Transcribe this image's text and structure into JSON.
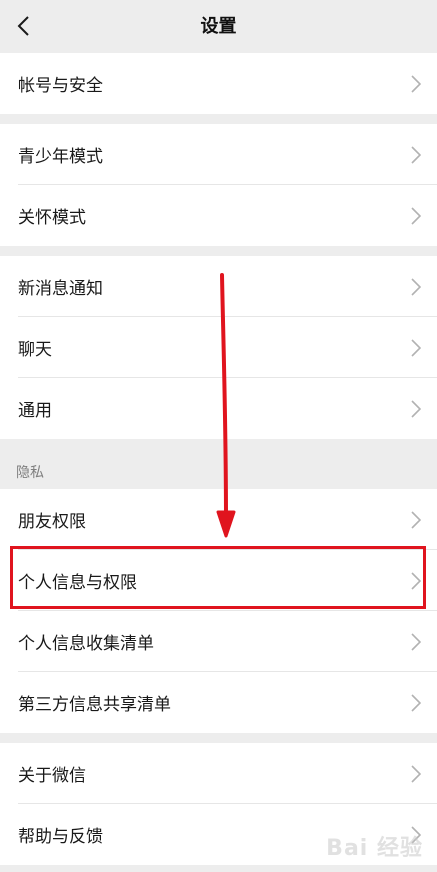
{
  "header": {
    "title": "设置"
  },
  "groups": [
    {
      "items": [
        {
          "label": "帐号与安全"
        }
      ]
    },
    {
      "items": [
        {
          "label": "青少年模式"
        },
        {
          "label": "关怀模式"
        }
      ]
    },
    {
      "items": [
        {
          "label": "新消息通知"
        },
        {
          "label": "聊天"
        },
        {
          "label": "通用"
        }
      ]
    },
    {
      "section_label": "隐私",
      "items": [
        {
          "label": "朋友权限"
        },
        {
          "label": "个人信息与权限"
        },
        {
          "label": "个人信息收集清单"
        },
        {
          "label": "第三方信息共享清单"
        }
      ]
    },
    {
      "items": [
        {
          "label": "关于微信"
        },
        {
          "label": "帮助与反馈"
        }
      ]
    }
  ],
  "annotation": {
    "color": "#e0141e",
    "highlighted_item": "个人信息与权限"
  },
  "watermark": {
    "text": "Bai 经验"
  },
  "colors": {
    "background": "#ededed",
    "card": "#ffffff",
    "annotation_red": "#e0141e"
  }
}
